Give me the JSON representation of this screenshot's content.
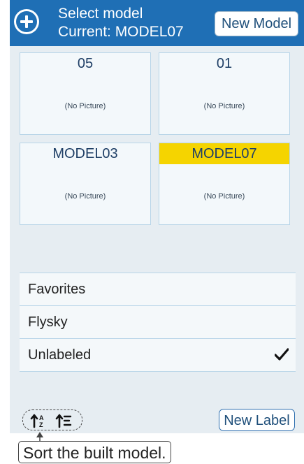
{
  "header": {
    "title": "Select model",
    "current": "Current: MODEL07",
    "new_model_label": "New Model",
    "icon": "add-circle-icon",
    "bg_color": "#1f6fb5"
  },
  "models": [
    {
      "name": "05",
      "picture": "(No Picture)",
      "current": false
    },
    {
      "name": "01",
      "picture": "(No Picture)",
      "current": false
    },
    {
      "name": "MODEL03",
      "picture": "(No Picture)",
      "current": false
    },
    {
      "name": "MODEL07",
      "picture": "(No Picture)",
      "current": true
    }
  ],
  "current_highlight_color": "#f5d400",
  "labels": [
    {
      "name": "Favorites",
      "checked": false
    },
    {
      "name": "Flysky",
      "checked": false
    },
    {
      "name": "Unlabeled",
      "checked": true
    }
  ],
  "footer": {
    "sort_icons": [
      "sort-alpha-icon",
      "sort-list-icon"
    ],
    "new_label_label": "New Label"
  },
  "tooltip": {
    "text": "Sort the built model."
  }
}
